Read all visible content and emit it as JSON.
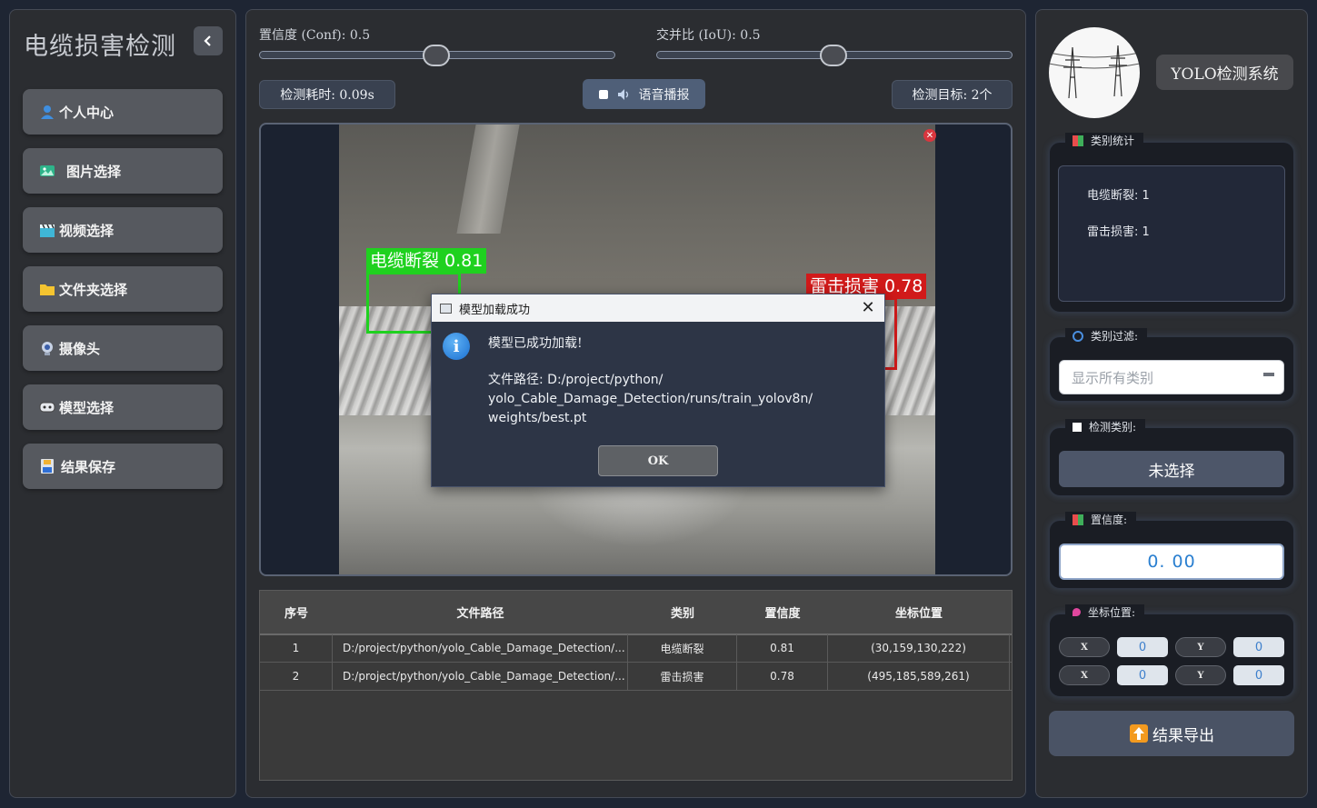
{
  "sidebar": {
    "title": "电缆损害检测",
    "items": [
      {
        "label": "个人中心",
        "icon": "user-icon"
      },
      {
        "label": "图片选择",
        "icon": "image-icon"
      },
      {
        "label": "视频选择",
        "icon": "clapper-icon"
      },
      {
        "label": "文件夹选择",
        "icon": "folder-icon"
      },
      {
        "label": "摄像头",
        "icon": "webcam-icon"
      },
      {
        "label": "模型选择",
        "icon": "model-icon"
      },
      {
        "label": "结果保存",
        "icon": "save-icon"
      }
    ]
  },
  "controls": {
    "conf_label": "置信度 (Conf): 0.5",
    "conf_value": 0.5,
    "iou_label": "交并比 (IoU): 0.5",
    "iou_value": 0.5,
    "time_label": "检测耗时: 0.09s",
    "voice_label": "语音播报",
    "target_label": "检测目标: 2个"
  },
  "detections": [
    {
      "label": "电缆断裂 0.81",
      "color": "#1fd11f"
    },
    {
      "label": "雷击损害 0.78",
      "color": "#d11a1a"
    }
  ],
  "dialog": {
    "title": "模型加载成功",
    "message": "模型已成功加载!",
    "path_line1": "文件路径: D:/project/python/",
    "path_line2": "yolo_Cable_Damage_Detection/runs/train_yolov8n/",
    "path_line3": "weights/best.pt",
    "ok_label": "OK"
  },
  "table": {
    "headers": [
      "序号",
      "文件路径",
      "类别",
      "置信度",
      "坐标位置"
    ],
    "rows": [
      [
        "1",
        "D:/project/python/yolo_Cable_Damage_Detection/...",
        "电缆断裂",
        "0.81",
        "(30,159,130,222)"
      ],
      [
        "2",
        "D:/project/python/yolo_Cable_Damage_Detection/...",
        "雷击损害",
        "0.78",
        "(495,185,589,261)"
      ]
    ]
  },
  "right": {
    "system_title": "YOLO检测系统",
    "stats_title": "类别统计",
    "stats": [
      "电缆断裂: 1",
      "雷击损害: 1"
    ],
    "filter_title": "类别过滤:",
    "filter_value": "显示所有类别",
    "detect_class_title": "检测类别:",
    "detect_class_value": "未选择",
    "conf_title": "置信度:",
    "conf_value": "0. 00",
    "coord_title": "坐标位置:",
    "coords": [
      {
        "label": "X",
        "value": "0"
      },
      {
        "label": "Y",
        "value": "0"
      },
      {
        "label": "X",
        "value": "0"
      },
      {
        "label": "Y",
        "value": "0"
      }
    ],
    "export_label": "结果导出"
  },
  "colors": {
    "accent": "#4f5f78",
    "panel": "#2b2d31",
    "background": "#1e2533"
  }
}
